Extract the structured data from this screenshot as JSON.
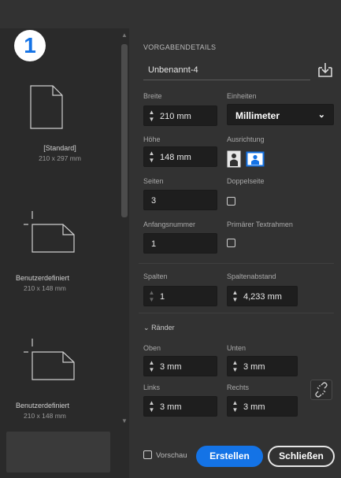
{
  "step_badge": "1",
  "presets": [
    {
      "name": "[Standard]",
      "dims": "210 x 297 mm",
      "icon": "portrait-page-icon"
    },
    {
      "name": "Benutzerdefiniert",
      "dims": "210 x 148 mm",
      "icon": "landscape-page-icon"
    },
    {
      "name": "Benutzerdefiniert",
      "dims": "210 x 148 mm",
      "icon": "landscape-page-icon"
    }
  ],
  "details": {
    "section_title": "VORGABENDETAILS",
    "document_name": "Unbenannt-4",
    "save_icon": "save-preset-icon",
    "width_label": "Breite",
    "width_value": "210 mm",
    "units_label": "Einheiten",
    "units_value": "Millimeter",
    "height_label": "Höhe",
    "height_value": "148 mm",
    "orientation_label": "Ausrichtung",
    "orientation_selected": "landscape",
    "pages_label": "Seiten",
    "pages_value": "3",
    "facing_label": "Doppelseite",
    "facing_checked": false,
    "start_label": "Anfangsnummer",
    "start_value": "1",
    "primary_frame_label": "Primärer Textrahmen",
    "primary_frame_checked": false,
    "columns_label": "Spalten",
    "columns_value": "1",
    "gutter_label": "Spaltenabstand",
    "gutter_value": "4,233 mm"
  },
  "margins": {
    "title": "Ränder",
    "expanded": true,
    "top_label": "Oben",
    "top_value": "3 mm",
    "bottom_label": "Unten",
    "bottom_value": "3 mm",
    "left_label": "Links",
    "left_value": "3 mm",
    "right_label": "Rechts",
    "right_value": "3 mm",
    "link_icon": "unlink-icon"
  },
  "footer": {
    "preview_label": "Vorschau",
    "preview_checked": false,
    "create_label": "Erstellen",
    "close_label": "Schließen"
  },
  "colors": {
    "accent": "#1473e6",
    "panel": "#323232",
    "left_panel": "#2a2a2a",
    "field": "#1e1e1e"
  }
}
